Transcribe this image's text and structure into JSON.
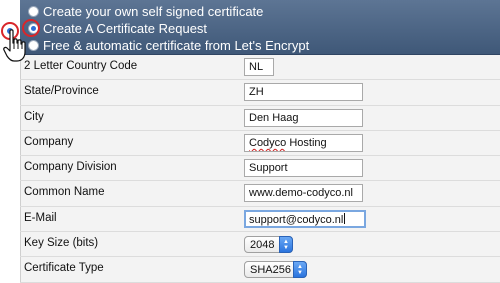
{
  "options": [
    {
      "label": "Create your own self signed certificate",
      "checked": false
    },
    {
      "label": "Create A Certificate Request",
      "checked": true
    },
    {
      "label": "Free & automatic certificate from Let's Encrypt",
      "checked": false
    }
  ],
  "form": {
    "country": {
      "label": "2 Letter Country Code",
      "value": "NL"
    },
    "state": {
      "label": "State/Province",
      "value": "ZH"
    },
    "city": {
      "label": "City",
      "value": "Den Haag"
    },
    "company": {
      "label": "Company",
      "value_misspelled": "Codyco",
      "value_rest": " Hosting"
    },
    "division": {
      "label": "Company Division",
      "value": "Support"
    },
    "common_name": {
      "label": "Common Name",
      "value": "www.demo-codyco.nl"
    },
    "email": {
      "label": "E-Mail",
      "value": "support@codyco.nl"
    },
    "key_size": {
      "label": "Key Size (bits)",
      "selected": "2048"
    },
    "cert_type": {
      "label": "Certificate Type",
      "selected": "SHA256"
    }
  },
  "colors": {
    "header_top": "#5d7594",
    "header_bottom": "#3f5878",
    "highlight": "#d8262a",
    "select_accent": "#2b74de"
  },
  "icons": {
    "cursor": "hand-pointer-icon",
    "stepper": "up-down-arrows-icon"
  }
}
